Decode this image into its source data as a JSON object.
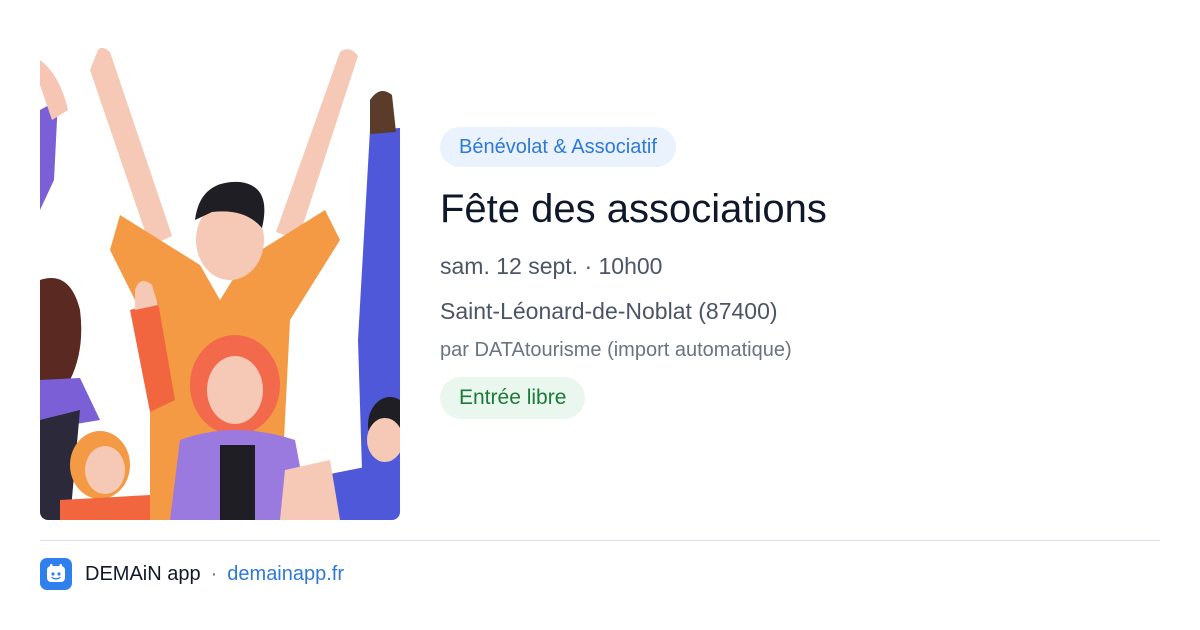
{
  "event": {
    "category": "Bénévolat & Associatif",
    "title": "Fête des associations",
    "datetime": "sam. 12 sept. · 10h00",
    "location": "Saint-Léonard-de-Noblat (87400)",
    "source": "par DATAtourisme (import automatique)",
    "price": "Entrée libre",
    "image_icon": "people-celebrating-illustration"
  },
  "footer": {
    "app_name": "DEMAiN app",
    "separator": "·",
    "domain": "demainapp.fr",
    "app_icon": "demain-app-icon"
  },
  "colors": {
    "category_bg": "#eaf2fd",
    "category_text": "#2f79d6",
    "price_bg": "#eaf7ee",
    "price_text": "#1c7a39",
    "link": "#2f79d6",
    "app_icon_bg": "#2f80ed"
  }
}
